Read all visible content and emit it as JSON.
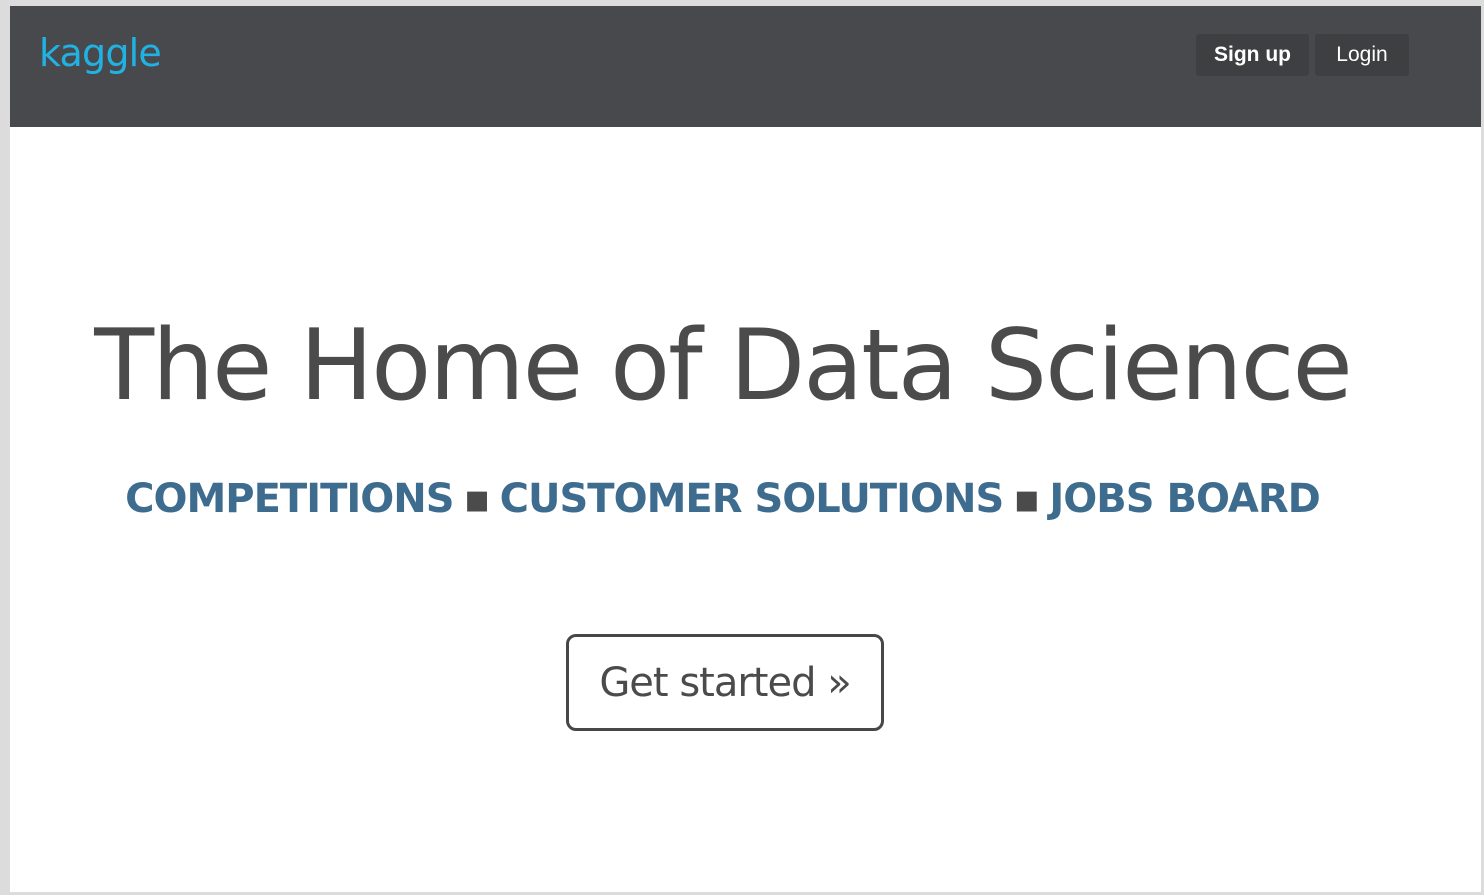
{
  "header": {
    "logo_text": "kaggle",
    "signup_label": "Sign up",
    "login_label": "Login"
  },
  "hero": {
    "title": "The Home of Data Science",
    "links": {
      "competitions": "COMPETITIONS",
      "customer_solutions": "CUSTOMER SOLUTIONS",
      "jobs_board": "JOBS BOARD"
    },
    "separator": "▪",
    "cta_label": "Get started »"
  },
  "colors": {
    "header_bg": "#48494c",
    "logo": "#21b2e4",
    "link": "#3d6c8e",
    "text": "#4b4b4b"
  }
}
